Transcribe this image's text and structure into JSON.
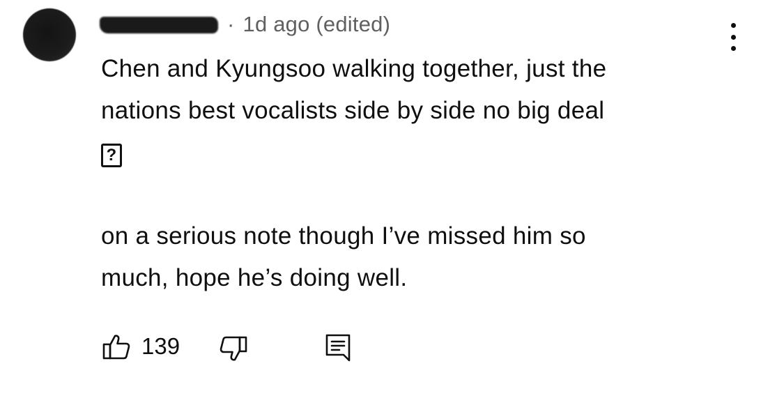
{
  "comment": {
    "author": "",
    "time": "1d ago",
    "edited": "(edited)",
    "separator": "·",
    "body": {
      "line1": "Chen and Kyungsoo walking together, just the",
      "line2": "nations best vocalists side by side no big deal",
      "emoji_placeholder": "?",
      "line3": "on a serious note though I’ve missed him so",
      "line4": "much, hope he’s doing well."
    },
    "like_count": "139"
  },
  "icons": {
    "menu": "more-vertical-icon",
    "like": "thumb-up-icon",
    "dislike": "thumb-down-icon",
    "reply": "reply-comment-icon"
  },
  "colors": {
    "text": "#0f0f0f",
    "meta": "#606060",
    "background": "#ffffff"
  }
}
